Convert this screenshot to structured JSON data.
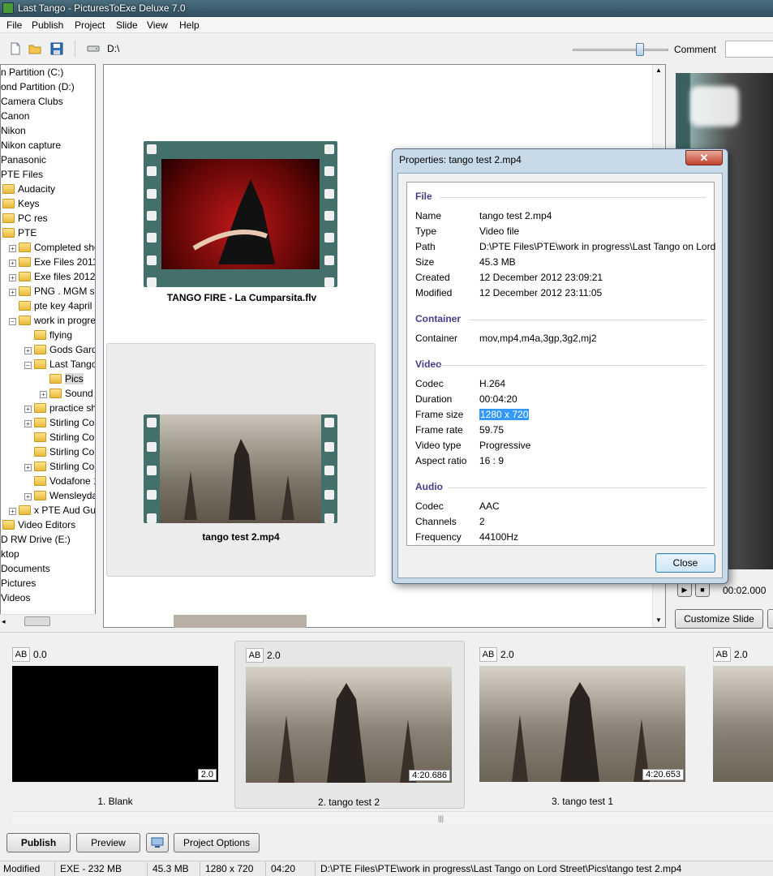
{
  "window": {
    "title": "Last Tango - PicturesToExe Deluxe 7.0"
  },
  "menu": [
    "File",
    "Publish",
    "Project",
    "Slide",
    "View",
    "Help"
  ],
  "toolbar": {
    "path": "D:\\",
    "comment_label": "Comment",
    "comment_value": ""
  },
  "tree": [
    {
      "label": "n Partition (C:)",
      "indent": 0
    },
    {
      "label": "ond Partition (D:)",
      "indent": 0
    },
    {
      "label": "Camera Clubs",
      "indent": 0
    },
    {
      "label": "Canon",
      "indent": 0
    },
    {
      "label": "Nikon",
      "indent": 0
    },
    {
      "label": "Nikon capture",
      "indent": 0
    },
    {
      "label": "Panasonic",
      "indent": 0
    },
    {
      "label": "PTE Files",
      "indent": 0
    },
    {
      "label": "Audacity",
      "indent": 1
    },
    {
      "label": "Keys",
      "indent": 1
    },
    {
      "label": "PC res",
      "indent": 1
    },
    {
      "label": "PTE",
      "indent": 1
    },
    {
      "label": "Completed sho",
      "indent": 2
    },
    {
      "label": "Exe Files 2011",
      "indent": 2
    },
    {
      "label": "Exe files 2012",
      "indent": 2
    },
    {
      "label": "PNG . MGM sh",
      "indent": 2
    },
    {
      "label": "pte key 4april",
      "indent": 2
    },
    {
      "label": "work in progres",
      "indent": 2
    },
    {
      "label": "flying",
      "indent": 3
    },
    {
      "label": "Gods Garde",
      "indent": 3
    },
    {
      "label": "Last Tango",
      "indent": 3
    },
    {
      "label": "Pics",
      "indent": 4
    },
    {
      "label": "Sound",
      "indent": 4
    },
    {
      "label": "practice sho",
      "indent": 3
    },
    {
      "label": "Stirling Cou",
      "indent": 3
    },
    {
      "label": "Stirling Cou",
      "indent": 3
    },
    {
      "label": "Stirling Cou",
      "indent": 3
    },
    {
      "label": "Stirling Cou",
      "indent": 3
    },
    {
      "label": "Vodafone 1",
      "indent": 3
    },
    {
      "label": "Wensleydal",
      "indent": 3
    },
    {
      "label": "x PTE Aud Guid",
      "indent": 2
    },
    {
      "label": "Video Editors",
      "indent": 1
    },
    {
      "label": "D RW Drive (E:)",
      "indent": 0
    },
    {
      "label": "ktop",
      "indent": 0
    },
    {
      "label": "Documents",
      "indent": 0
    },
    {
      "label": "Pictures",
      "indent": 0
    },
    {
      "label": "Videos",
      "indent": 0
    }
  ],
  "browser": {
    "items": [
      {
        "caption": "TANGO FIRE - La Cumparsita.flv"
      },
      {
        "caption": "tango test 2.mp4"
      }
    ]
  },
  "preview": {
    "time": "00:02.000",
    "customize_label": "Customize Slide"
  },
  "dialog": {
    "title": "Properties: tango test 2.mp4",
    "close_x": "✕",
    "close_label": "Close",
    "sections": [
      {
        "heading": "File",
        "rows": [
          {
            "label": "Name",
            "value": "tango test 2.mp4"
          },
          {
            "label": "Type",
            "value": "Video file"
          },
          {
            "label": "Path",
            "value": "D:\\PTE Files\\PTE\\work in progress\\Last Tango on Lord"
          },
          {
            "label": "Size",
            "value": "45.3 MB"
          },
          {
            "label": "Created",
            "value": "12 December 2012  23:09:21"
          },
          {
            "label": "Modified",
            "value": "12 December 2012  23:11:05"
          }
        ]
      },
      {
        "heading": "Container",
        "rows": [
          {
            "label": "Container",
            "value": "mov,mp4,m4a,3gp,3g2,mj2"
          }
        ]
      },
      {
        "heading": "Video",
        "rows": [
          {
            "label": "Codec",
            "value": "H.264"
          },
          {
            "label": "Duration",
            "value": "00:04:20"
          },
          {
            "label": "Frame size",
            "value": "1280 x 720"
          },
          {
            "label": "Frame rate",
            "value": "59.75"
          },
          {
            "label": "Video type",
            "value": "Progressive"
          },
          {
            "label": "Aspect ratio",
            "value": "16 : 9"
          }
        ]
      },
      {
        "heading": "Audio",
        "rows": [
          {
            "label": "Codec",
            "value": "AAC"
          },
          {
            "label": "Channels",
            "value": "2"
          },
          {
            "label": "Frequency",
            "value": "44100Hz"
          }
        ]
      }
    ]
  },
  "slides": [
    {
      "ab": "AB",
      "duration": "0.0",
      "time": "2.0",
      "label": "1. Blank"
    },
    {
      "ab": "AB",
      "duration": "2.0",
      "time": "4:20.686",
      "label": "2. tango test 2"
    },
    {
      "ab": "AB",
      "duration": "2.0",
      "time": "4:20.653",
      "label": "3. tango test 1"
    },
    {
      "ab": "AB",
      "duration": "2.0",
      "time": "",
      "label": ""
    }
  ],
  "buttons": {
    "publish": "Publish",
    "preview": "Preview",
    "project_options": "Project Options"
  },
  "status": {
    "state": "Modified",
    "exe": "EXE - 232 MB",
    "size": "45.3 MB",
    "frame": "1280 x 720",
    "duration": "04:20",
    "path": "D:\\PTE Files\\PTE\\work in progress\\Last Tango on Lord Street\\Pics\\tango test 2.mp4"
  },
  "colors": {
    "section_heading": "#4a3c8a",
    "selection": "#3399ff",
    "filmstrip": "#44706c"
  }
}
